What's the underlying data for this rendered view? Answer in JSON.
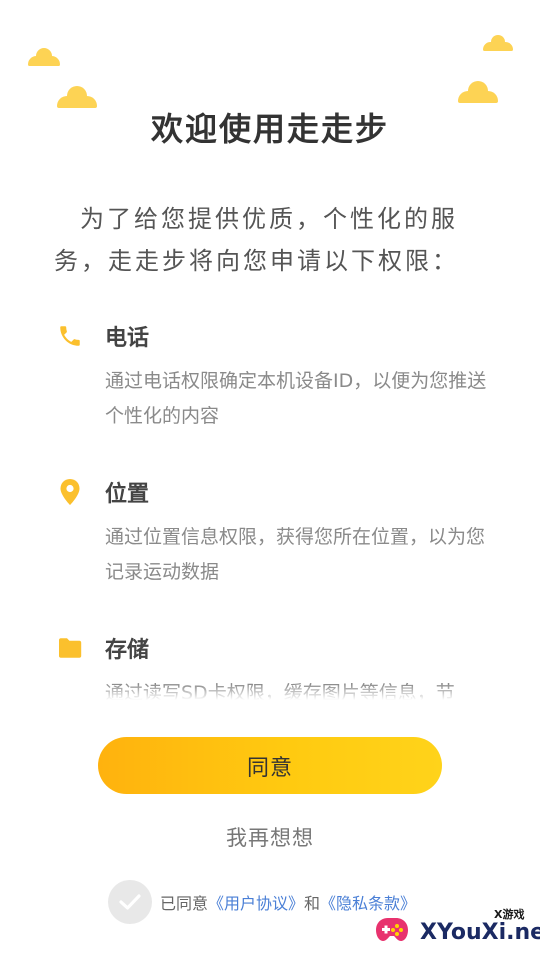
{
  "title": "欢迎使用走走步",
  "intro": "为了给您提供优质，个性化的服务，走走步将向您申请以下权限：",
  "permissions": [
    {
      "icon": "phone-icon",
      "title": "电话",
      "desc": "通过电话权限确定本机设备ID，以便为您推送个性化的内容"
    },
    {
      "icon": "location-icon",
      "title": "位置",
      "desc": "通过位置信息权限，获得您所在位置，以为您记录运动数据"
    },
    {
      "icon": "folder-icon",
      "title": "存储",
      "desc": "通过读写SD卡权限，缓存图片等信息，节"
    }
  ],
  "agree_label": "同意",
  "decline_label": "我再想想",
  "consent": {
    "prefix": "已同意",
    "user_agreement": "《用户协议》",
    "and": "和",
    "privacy_policy": "《隐私条款》"
  },
  "watermark": {
    "small": "X游戏",
    "big": "XYouXi.net"
  },
  "colors": {
    "accent": "#FFC107",
    "icon": "#FBC02D",
    "link": "#4A7FD6"
  }
}
